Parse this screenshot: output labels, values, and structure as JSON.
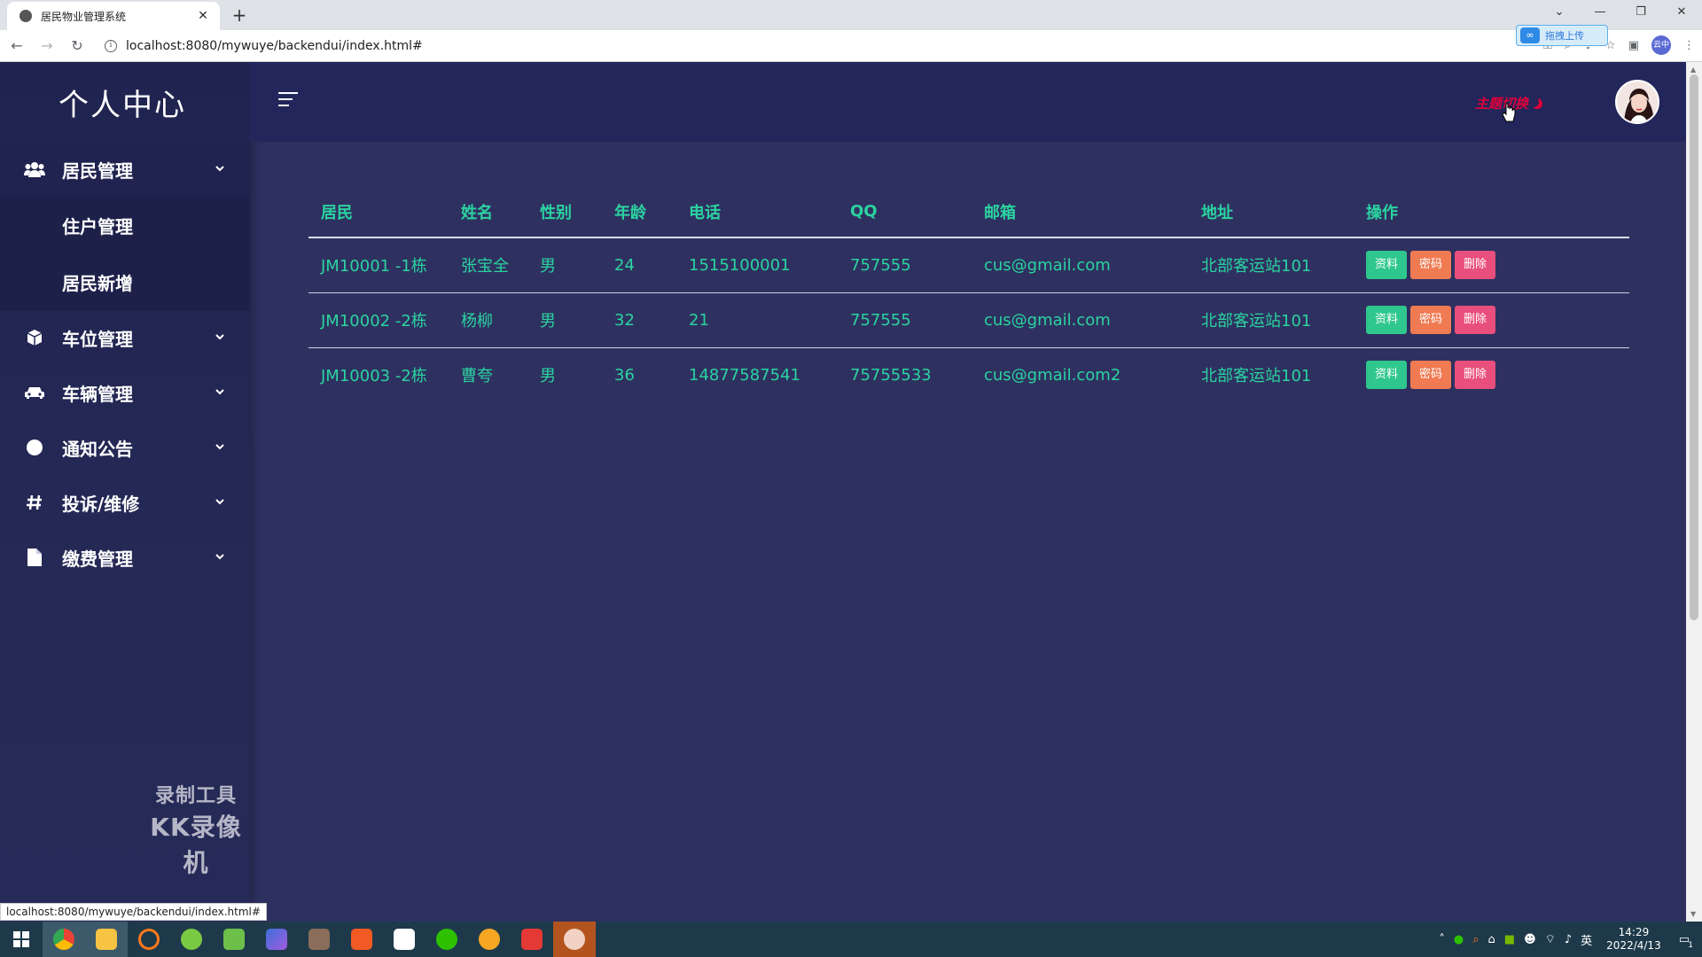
{
  "browser": {
    "tab_title": "居民物业管理系统",
    "tab_close": "✕",
    "new_tab": "+",
    "url": "localhost:8080/mywuye/backendui/index.html#",
    "upload_pill": "拖拽上传",
    "profile_label": "云中",
    "status_url": "localhost:8080/mywuye/backendui/index.html#",
    "window_controls": [
      "⌄",
      "—",
      "❐",
      "✕"
    ]
  },
  "sidebar": {
    "brand": "个人中心",
    "menu": [
      {
        "label": "居民管理",
        "icon": "users-icon",
        "open": true,
        "children": [
          {
            "label": "住户管理"
          },
          {
            "label": "居民新增"
          }
        ]
      },
      {
        "label": "车位管理",
        "icon": "cube-icon"
      },
      {
        "label": "车辆管理",
        "icon": "car-icon"
      },
      {
        "label": "通知公告",
        "icon": "circle-icon"
      },
      {
        "label": "投诉/维修",
        "icon": "hashtag-icon"
      },
      {
        "label": "缴费管理",
        "icon": "file-icon"
      }
    ]
  },
  "watermark": {
    "line1": "录制工具",
    "line2": "KK录像机"
  },
  "header": {
    "theme_switch": "主题切换"
  },
  "table": {
    "headers": [
      "居民",
      "姓名",
      "性别",
      "年龄",
      "电话",
      "QQ",
      "邮箱",
      "地址",
      "操作"
    ],
    "rows": [
      {
        "resident": "JM10001 -1栋",
        "name": "张宝全",
        "gender": "男",
        "age": "24",
        "phone": "1515100001",
        "qq": "757555",
        "email": "cus@gmail.com",
        "address": "北部客运站101"
      },
      {
        "resident": "JM10002 -2栋",
        "name": "杨柳",
        "gender": "男",
        "age": "32",
        "phone": "21",
        "qq": "757555",
        "email": "cus@gmail.com",
        "address": "北部客运站101"
      },
      {
        "resident": "JM10003 -2栋",
        "name": "曹夸",
        "gender": "男",
        "age": "36",
        "phone": "14877587541",
        "qq": "75755533",
        "email": "cus@gmail.com2",
        "address": "北部客运站101"
      }
    ],
    "actions": {
      "info": "资料",
      "password": "密码",
      "delete": "删除"
    }
  },
  "taskbar": {
    "time": "14:29",
    "date": "2022/4/13",
    "ime": "英",
    "notification_count": "1"
  },
  "colors": {
    "accent_text": "#2bd3a0",
    "sidebar_bg": "#202350",
    "main_bg": "#2e3160",
    "theme_switch": "#e0003a",
    "btn_info": "#2fc78d",
    "btn_password": "#f07a52",
    "btn_delete": "#e94f7c"
  }
}
